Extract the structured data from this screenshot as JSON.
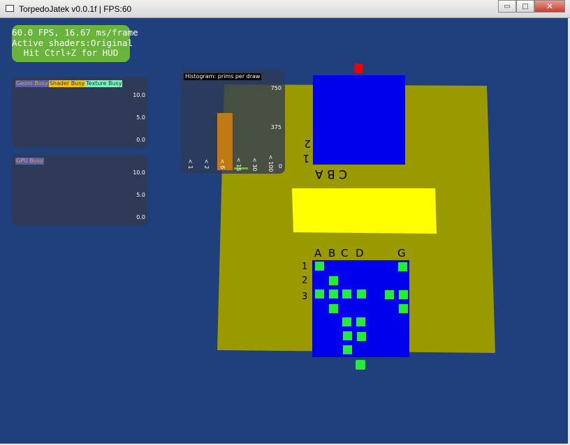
{
  "window": {
    "title": "TorpedoJatek v0.0.1f | FPS:60",
    "controls": {
      "minimize": "▭",
      "maximize": "□",
      "close": "✕"
    }
  },
  "hud": {
    "fps_line": "60.0 FPS, 16.67 ms/frame",
    "shader_line": "Active shaders:Original",
    "hint_line": "Hit Ctrl+Z for HUD"
  },
  "cpu_panel": {
    "legend": [
      "Geom Busy",
      "Shader Busy",
      "Texture Busy"
    ],
    "ticks": [
      "10.0",
      "5.0",
      "0.0"
    ]
  },
  "gpu_panel": {
    "legend": [
      "GPU Busy"
    ],
    "ticks": [
      "10.0",
      "5.0",
      "0.0"
    ]
  },
  "histogram": {
    "title": "Histogram: prims per draw",
    "y_ticks": [
      "750",
      "375",
      "0"
    ],
    "x_labels": [
      "< 1",
      "< 2",
      "< 6",
      "< 15",
      "< 30",
      "< 100"
    ]
  },
  "board": {
    "top_side_labels": [
      "2",
      "1"
    ],
    "top_row_label": "C B A",
    "col_labels": [
      "A",
      "B",
      "C",
      "D",
      "G"
    ],
    "row_labels": [
      "1",
      "2",
      "3"
    ]
  },
  "colors": {
    "background": "#1f3f7d",
    "board": "#9a9a00",
    "grid": "#0000ee",
    "marker": "#22ee33",
    "highlight": "#ffff00",
    "hud_green": "#69b43a"
  }
}
